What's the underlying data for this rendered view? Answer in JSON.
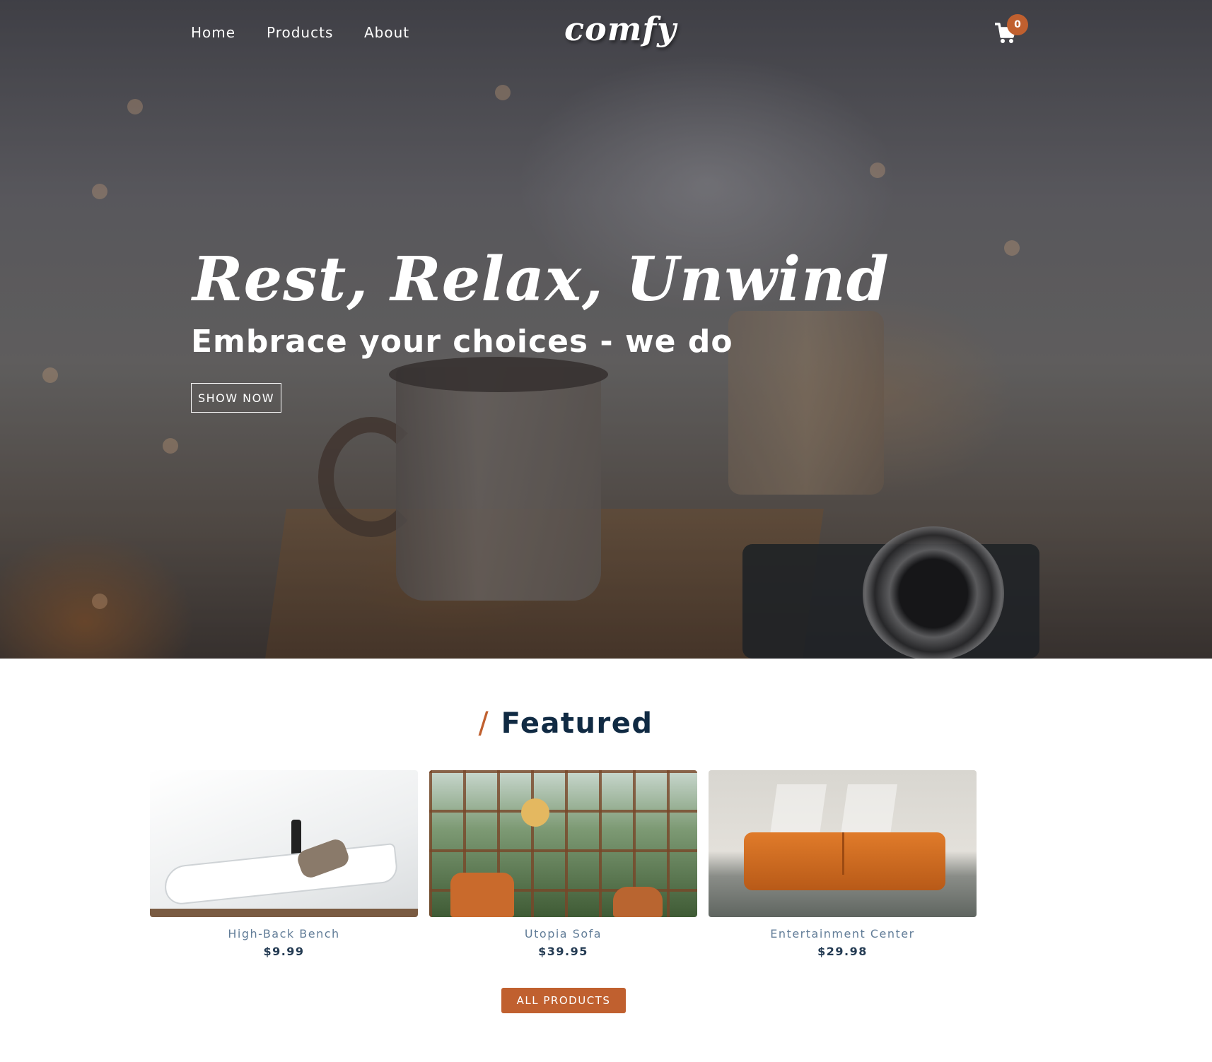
{
  "nav": {
    "links": [
      "Home",
      "Products",
      "About"
    ],
    "logo": "comfy",
    "cart_count": "0"
  },
  "hero": {
    "title": "Rest, Relax, Unwind",
    "subtitle": "Embrace your choices - we do",
    "button": "SHOW NOW"
  },
  "featured": {
    "slash": "/",
    "title": "Featured",
    "products": [
      {
        "name": "High-Back Bench",
        "price": "$9.99"
      },
      {
        "name": "Utopia Sofa",
        "price": "$39.95"
      },
      {
        "name": "Entertainment Center",
        "price": "$29.98"
      }
    ],
    "all_button": "ALL PRODUCTS"
  },
  "colors": {
    "accent": "#c0602f",
    "heading": "#102a43",
    "muted": "#627d98"
  },
  "icons": {
    "cart": "cart-icon"
  }
}
